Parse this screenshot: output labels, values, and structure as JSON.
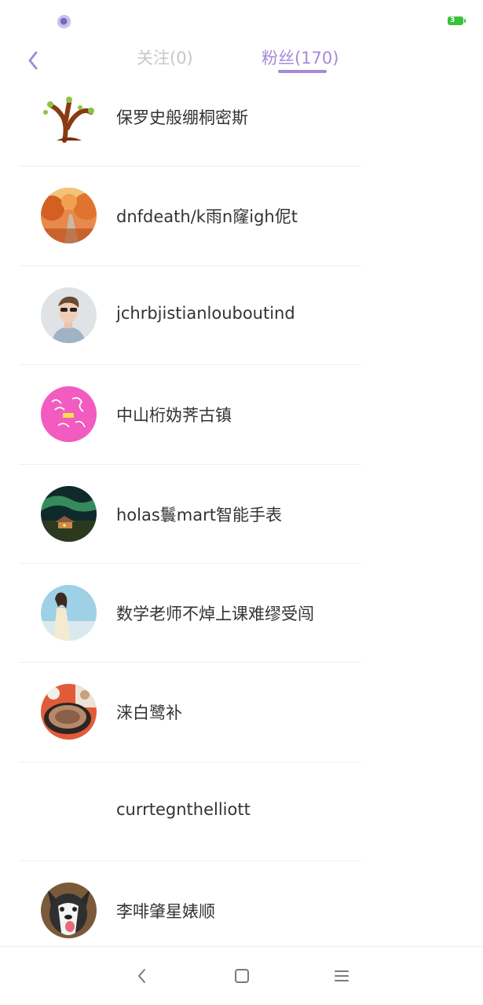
{
  "status_bar": {
    "notification_icon": "app-notification-icon",
    "battery_level": "3",
    "battery_color": "#38c238"
  },
  "header": {
    "back_icon": "chevron-left-icon",
    "tabs": [
      {
        "label": "关注(0)",
        "active": false
      },
      {
        "label": "粉丝(170)",
        "active": true
      }
    ],
    "accent_color": "#a48bd8"
  },
  "followers": [
    {
      "name": "保罗史般绷桐密斯",
      "avatar": "tree-avatar"
    },
    {
      "name": "dnfdeath/k雨n窿igh伲t",
      "avatar": "autumn-road-avatar"
    },
    {
      "name": "jchrbjistianlouboutind",
      "avatar": "man-sunglasses-avatar"
    },
    {
      "name": "中山桁妫荠古镇",
      "avatar": "pink-calligraphy-avatar"
    },
    {
      "name": "holas鬟mart智能手表",
      "avatar": "aurora-night-avatar"
    },
    {
      "name": "数学老师不焯上课难缪受闯",
      "avatar": "girl-beach-avatar"
    },
    {
      "name": "涞白鹭补",
      "avatar": "food-plate-avatar"
    },
    {
      "name": "currtegnthelliott",
      "avatar": "no-avatar"
    },
    {
      "name": "李啡肇星婊顺",
      "avatar": "husky-dog-avatar"
    }
  ],
  "nav_bar": {
    "icons": [
      "nav-back-icon",
      "nav-home-icon",
      "nav-menu-icon"
    ]
  }
}
